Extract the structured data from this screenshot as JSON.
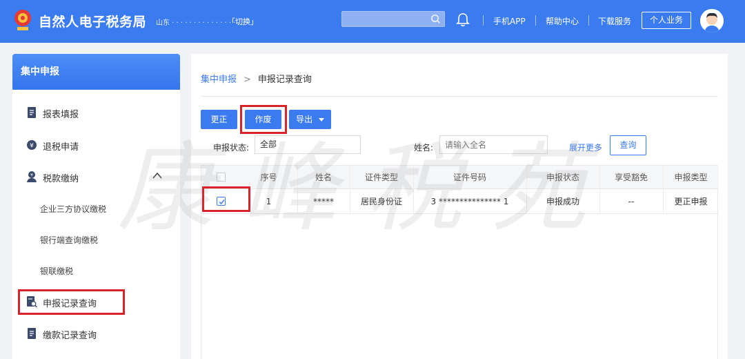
{
  "header": {
    "app_title": "自然人电子税务局",
    "region": "山东 · · · · · · · · · · · · · · · ...",
    "switch_label": "「切换」",
    "search_placeholder": "",
    "links": [
      "手机APP",
      "帮助中心",
      "下载服务"
    ],
    "personal_button": "个人业务"
  },
  "sidebar": {
    "title": "集中申报",
    "items": [
      {
        "label": "报表填报",
        "icon": "document-icon"
      },
      {
        "label": "退税申请",
        "icon": "refund-icon"
      },
      {
        "label": "税款缴纳",
        "icon": "payment-icon"
      }
    ],
    "sub_items": [
      "企业三方协议缴税",
      "银行端查询缴税",
      "银联缴税"
    ],
    "bottom_items": [
      {
        "label": "申报记录查询",
        "icon": "record-search-icon"
      },
      {
        "label": "缴款记录查询",
        "icon": "document-icon"
      }
    ]
  },
  "breadcrumb": {
    "root": "集中申报",
    "separator": ">",
    "current": "申报记录查询"
  },
  "toolbar": {
    "correct_label": "更正",
    "void_label": "作废",
    "export_label": "导出"
  },
  "filters": {
    "status_label": "申报状态:",
    "status_value": "全部",
    "name_label": "姓名:",
    "name_placeholder": "请输入全名",
    "expand_label": "展开更多",
    "query_label": "查询"
  },
  "table": {
    "columns": [
      "序号",
      "姓名",
      "证件类型",
      "证件号码",
      "申报状态",
      "享受豁免",
      "申报类型"
    ],
    "rows": [
      {
        "index": "1",
        "name": "*****",
        "id_type": "居民身份证",
        "id_number": "3 *************** 1",
        "status": "申报成功",
        "exemption": "--",
        "type": "更正申报"
      }
    ]
  },
  "watermark": "康峰税苑",
  "colors": {
    "primary": "#3b7bf0",
    "annotation": "#d8232a"
  }
}
